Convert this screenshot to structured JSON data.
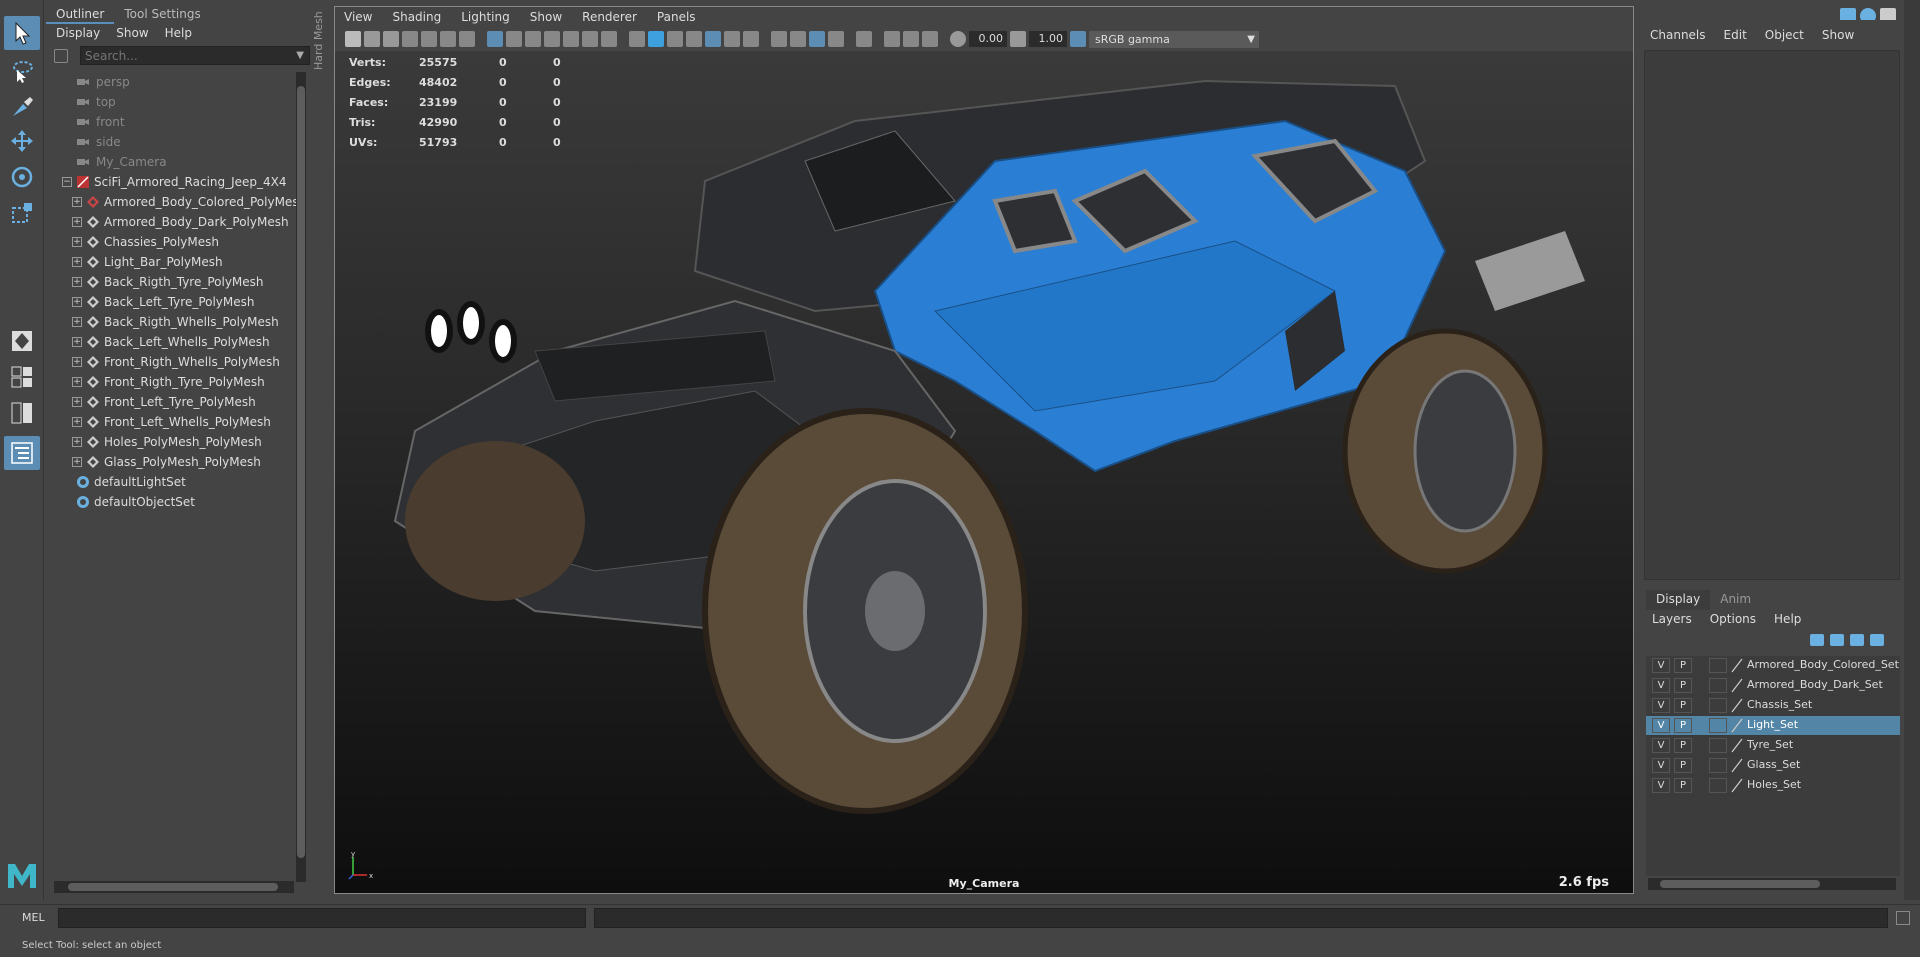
{
  "toolbox": {
    "tools": [
      "select-tool-icon",
      "lasso-tool-icon",
      "paint-tool-icon",
      "move-tool-icon",
      "rotate-tool-icon",
      "scale-tool-icon"
    ],
    "layout_icons": [
      "single-view-icon",
      "four-view-icon",
      "two-view-icon",
      "outliner-layout-icon"
    ]
  },
  "outliner": {
    "tabs": [
      "Outliner",
      "Tool Settings"
    ],
    "menu": [
      "Display",
      "Show",
      "Help"
    ],
    "search_placeholder": "Search...",
    "cameras": [
      "persp",
      "top",
      "front",
      "side",
      "My_Camera"
    ],
    "group": "SciFi_Armored_Racing_Jeep_4X4",
    "meshes": [
      "Armored_Body_Colored_PolyMesh",
      "Armored_Body_Dark_PolyMesh",
      "Chassies_PolyMesh",
      "Light_Bar_PolyMesh",
      "Back_Rigth_Tyre_PolyMesh",
      "Back_Left_Tyre_PolyMesh",
      "Back_Rigth_Whells_PolyMesh",
      "Back_Left_Whells_PolyMesh",
      "Front_Rigth_Whells_PolyMesh",
      "Front_Rigth_Tyre_PolyMesh",
      "Front_Left_Tyre_PolyMesh",
      "Front_Left_Whells_PolyMesh",
      "Holes_PolyMesh_PolyMesh",
      "Glass_PolyMesh_PolyMesh"
    ],
    "sets": [
      "defaultLightSet",
      "defaultObjectSet"
    ]
  },
  "viewport": {
    "side_label": "Hard Mesh",
    "menu": [
      "View",
      "Shading",
      "Lighting",
      "Show",
      "Renderer",
      "Panels"
    ],
    "exposure": "0.00",
    "gamma": "1.00",
    "color_space": "sRGB gamma",
    "hud": [
      {
        "label": "Verts:",
        "v1": "25575",
        "v2": "0",
        "v3": "0"
      },
      {
        "label": "Edges:",
        "v1": "48402",
        "v2": "0",
        "v3": "0"
      },
      {
        "label": "Faces:",
        "v1": "23199",
        "v2": "0",
        "v3": "0"
      },
      {
        "label": "Tris:",
        "v1": "42990",
        "v2": "0",
        "v3": "0"
      },
      {
        "label": "UVs:",
        "v1": "51793",
        "v2": "0",
        "v3": "0"
      }
    ],
    "camera_name": "My_Camera",
    "fps": "2.6 fps",
    "axis_x": "x",
    "axis_y": "y",
    "colors": {
      "body_blue": "#2a7fd4",
      "armor_dark": "#2b2d30",
      "tyre": "#5a4a38"
    }
  },
  "channel_box": {
    "menu": [
      "Channels",
      "Edit",
      "Object",
      "Show"
    ]
  },
  "layer_editor": {
    "tabs": [
      "Display",
      "Anim"
    ],
    "menu": [
      "Layers",
      "Options",
      "Help"
    ],
    "layers": [
      {
        "v": "V",
        "p": "P",
        "name": "Armored_Body_Colored_Set"
      },
      {
        "v": "V",
        "p": "P",
        "name": "Armored_Body_Dark_Set"
      },
      {
        "v": "V",
        "p": "P",
        "name": "Chassis_Set"
      },
      {
        "v": "V",
        "p": "P",
        "name": "Light_Set"
      },
      {
        "v": "V",
        "p": "P",
        "name": "Tyre_Set"
      },
      {
        "v": "V",
        "p": "P",
        "name": "Glass_Set"
      },
      {
        "v": "V",
        "p": "P",
        "name": "Holes_Set"
      }
    ]
  },
  "command_line": {
    "label": "MEL"
  },
  "status_line": {
    "text": "Select Tool: select an object"
  }
}
